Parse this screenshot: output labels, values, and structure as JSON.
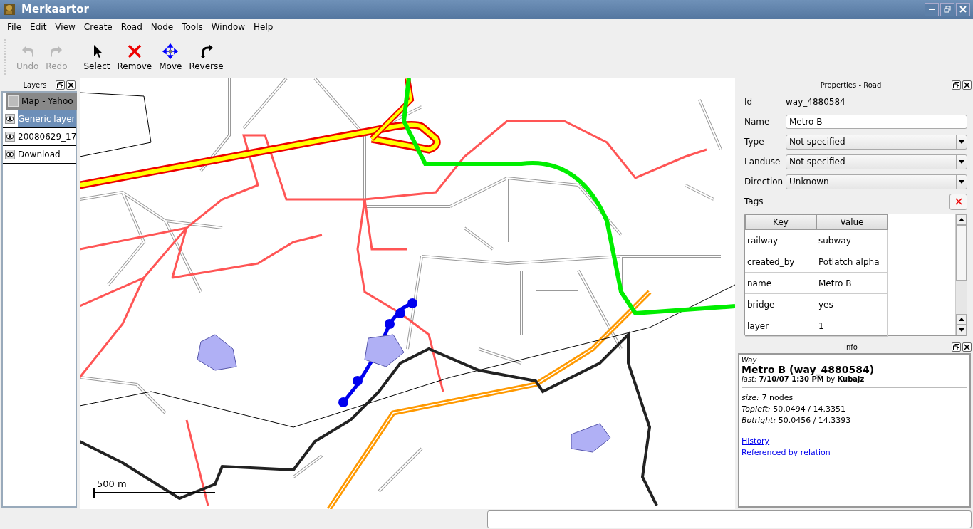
{
  "window": {
    "title": "Merkaartor"
  },
  "menu": [
    "File",
    "Edit",
    "View",
    "Create",
    "Road",
    "Node",
    "Tools",
    "Window",
    "Help"
  ],
  "toolbar": [
    {
      "label": "Undo",
      "kind": "undo",
      "disabled": true
    },
    {
      "label": "Redo",
      "kind": "redo",
      "disabled": true
    },
    {
      "label": "Select",
      "kind": "select",
      "disabled": false
    },
    {
      "label": "Remove",
      "kind": "remove",
      "disabled": false
    },
    {
      "label": "Move",
      "kind": "move",
      "disabled": false
    },
    {
      "label": "Reverse",
      "kind": "reverse",
      "disabled": false
    }
  ],
  "layers": {
    "title": "Layers",
    "items": [
      {
        "name": "Map - Yahoo",
        "kind": "map",
        "selected": false
      },
      {
        "name": "Generic layer",
        "kind": "drawing",
        "selected": true
      },
      {
        "name": "20080629_17",
        "kind": "drawing",
        "selected": false
      },
      {
        "name": "Download",
        "kind": "drawing",
        "selected": false
      }
    ]
  },
  "map": {
    "scale_label": "500 m"
  },
  "properties": {
    "title": "Properties - Road",
    "fields": [
      {
        "label": "Id",
        "value": "way_4880584",
        "kind": "text"
      },
      {
        "label": "Name",
        "value": "Metro B",
        "kind": "input"
      },
      {
        "label": "Type",
        "value": "Not specified",
        "kind": "select"
      },
      {
        "label": "Landuse",
        "value": "Not specified",
        "kind": "select"
      },
      {
        "label": "Direction",
        "value": "Unknown",
        "kind": "select"
      }
    ],
    "tags_label": "Tags",
    "tags": {
      "columns": [
        "Key",
        "Value"
      ],
      "rows": [
        [
          "railway",
          "subway"
        ],
        [
          "created_by",
          "Potlatch alpha"
        ],
        [
          "name",
          "Metro B"
        ],
        [
          "bridge",
          "yes"
        ],
        [
          "layer",
          "1"
        ]
      ]
    }
  },
  "info": {
    "title": "Info",
    "type": "Way",
    "heading": "Metro B (way_4880584)",
    "last": "*last:* **7/10/07 1:30 PM** by **Kubajz**",
    "details": [
      "*size:* 7 nodes",
      "*Topleft:* 50.0494 / 14.3351",
      "*Botright:* 50.0456 / 14.3393"
    ],
    "links": [
      "History",
      "Referenced by relation"
    ]
  }
}
